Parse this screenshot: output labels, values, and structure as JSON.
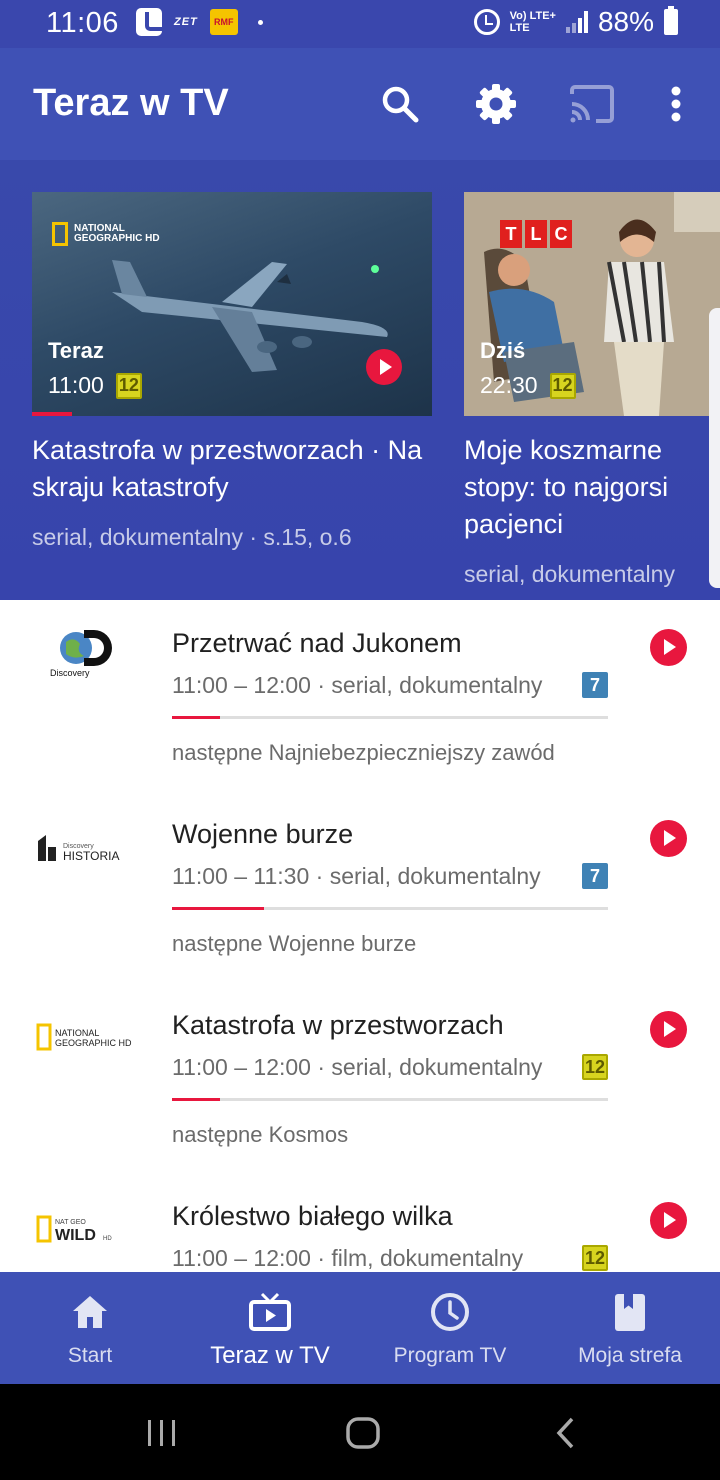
{
  "status_bar": {
    "time": "11:06",
    "zet_label": "ZET",
    "rmf_label": "RMF",
    "network_top": "Vo) LTE+",
    "network_bottom": "LTE",
    "battery": "88%"
  },
  "app_bar": {
    "title": "Teraz w TV",
    "icons": [
      "search-icon",
      "settings-icon",
      "cast-icon",
      "more-vert-icon"
    ]
  },
  "featured": [
    {
      "when": "Teraz",
      "time": "11:00",
      "age_rating": "12",
      "channel_logo": "NATIONAL GEOGRAPHIC HD",
      "title": "Katastrofa w przestworzach · Na skraju katastrofy",
      "subtitle": "serial, dokumentalny · s.15, o.6",
      "progress": 0.1
    },
    {
      "when": "Dziś",
      "time": "22:30",
      "age_rating": "12",
      "channel_logo": "TLC",
      "title": "Moje koszmarne stopy: to najgorsi pacjenci",
      "subtitle": "serial, dokumentalny"
    }
  ],
  "programs": [
    {
      "channel": "Discovery HD",
      "title": "Przetrwać nad Jukonem",
      "meta": "11:00 – 12:00 · serial, dokumentalny",
      "age_rating": "7",
      "age_color": "#3f82b5",
      "progress": 0.11,
      "next": "następne Najniebezpieczniejszy zawód"
    },
    {
      "channel": "Discovery HISTORIA",
      "title": "Wojenne burze",
      "meta": "11:00 – 11:30 · serial, dokumentalny",
      "age_rating": "7",
      "age_color": "#3f82b5",
      "progress": 0.21,
      "next": "następne Wojenne burze"
    },
    {
      "channel": "NATIONAL GEOGRAPHIC HD",
      "title": "Katastrofa w przestworzach",
      "meta": "11:00 – 12:00 · serial, dokumentalny",
      "age_rating": "12",
      "age_color": "#d7d41f",
      "progress": 0.11,
      "next": "następne Kosmos"
    },
    {
      "channel": "NAT GEO WILD HD",
      "title": "Królestwo białego wilka",
      "meta": "11:00 – 12:00 · film, dokumentalny",
      "age_rating": "12",
      "age_color": "#d7d41f"
    }
  ],
  "bottom_nav": [
    {
      "label": "Start",
      "icon": "home-icon",
      "active": false
    },
    {
      "label": "Teraz w TV",
      "icon": "tv-play-icon",
      "active": true
    },
    {
      "label": "Program TV",
      "icon": "clock-icon",
      "active": false
    },
    {
      "label": "Moja strefa",
      "icon": "bookmark-icon",
      "active": false
    }
  ],
  "colors": {
    "primary": "#3f51b5",
    "status_bar": "#3a47ad",
    "accent": "#e8173e"
  }
}
